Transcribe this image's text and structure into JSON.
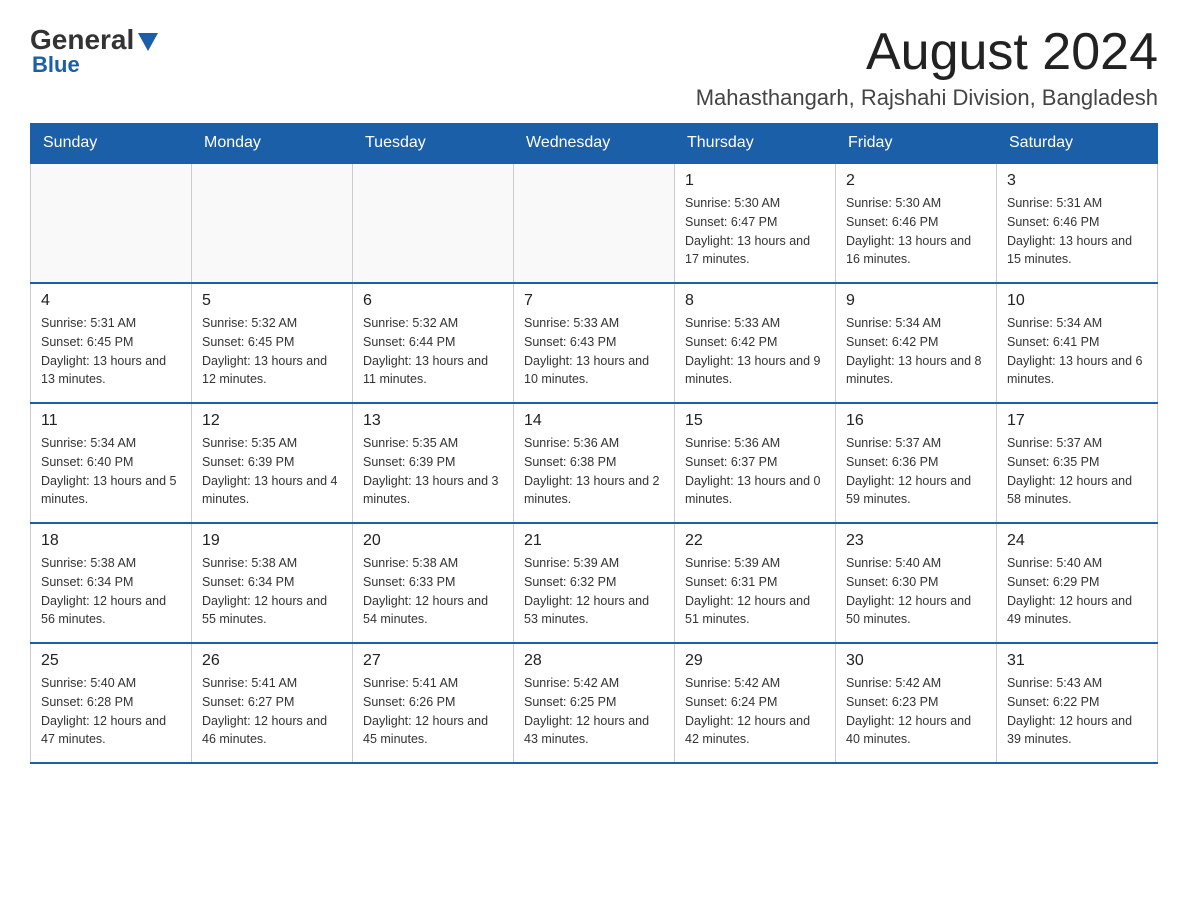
{
  "header": {
    "logo": {
      "general_text": "General",
      "blue_text": "Blue"
    },
    "title": "August 2024",
    "location": "Mahasthangarh, Rajshahi Division, Bangladesh"
  },
  "calendar": {
    "days_of_week": [
      "Sunday",
      "Monday",
      "Tuesday",
      "Wednesday",
      "Thursday",
      "Friday",
      "Saturday"
    ],
    "weeks": [
      [
        {
          "day": "",
          "info": ""
        },
        {
          "day": "",
          "info": ""
        },
        {
          "day": "",
          "info": ""
        },
        {
          "day": "",
          "info": ""
        },
        {
          "day": "1",
          "info": "Sunrise: 5:30 AM\nSunset: 6:47 PM\nDaylight: 13 hours and 17 minutes."
        },
        {
          "day": "2",
          "info": "Sunrise: 5:30 AM\nSunset: 6:46 PM\nDaylight: 13 hours and 16 minutes."
        },
        {
          "day": "3",
          "info": "Sunrise: 5:31 AM\nSunset: 6:46 PM\nDaylight: 13 hours and 15 minutes."
        }
      ],
      [
        {
          "day": "4",
          "info": "Sunrise: 5:31 AM\nSunset: 6:45 PM\nDaylight: 13 hours and 13 minutes."
        },
        {
          "day": "5",
          "info": "Sunrise: 5:32 AM\nSunset: 6:45 PM\nDaylight: 13 hours and 12 minutes."
        },
        {
          "day": "6",
          "info": "Sunrise: 5:32 AM\nSunset: 6:44 PM\nDaylight: 13 hours and 11 minutes."
        },
        {
          "day": "7",
          "info": "Sunrise: 5:33 AM\nSunset: 6:43 PM\nDaylight: 13 hours and 10 minutes."
        },
        {
          "day": "8",
          "info": "Sunrise: 5:33 AM\nSunset: 6:42 PM\nDaylight: 13 hours and 9 minutes."
        },
        {
          "day": "9",
          "info": "Sunrise: 5:34 AM\nSunset: 6:42 PM\nDaylight: 13 hours and 8 minutes."
        },
        {
          "day": "10",
          "info": "Sunrise: 5:34 AM\nSunset: 6:41 PM\nDaylight: 13 hours and 6 minutes."
        }
      ],
      [
        {
          "day": "11",
          "info": "Sunrise: 5:34 AM\nSunset: 6:40 PM\nDaylight: 13 hours and 5 minutes."
        },
        {
          "day": "12",
          "info": "Sunrise: 5:35 AM\nSunset: 6:39 PM\nDaylight: 13 hours and 4 minutes."
        },
        {
          "day": "13",
          "info": "Sunrise: 5:35 AM\nSunset: 6:39 PM\nDaylight: 13 hours and 3 minutes."
        },
        {
          "day": "14",
          "info": "Sunrise: 5:36 AM\nSunset: 6:38 PM\nDaylight: 13 hours and 2 minutes."
        },
        {
          "day": "15",
          "info": "Sunrise: 5:36 AM\nSunset: 6:37 PM\nDaylight: 13 hours and 0 minutes."
        },
        {
          "day": "16",
          "info": "Sunrise: 5:37 AM\nSunset: 6:36 PM\nDaylight: 12 hours and 59 minutes."
        },
        {
          "day": "17",
          "info": "Sunrise: 5:37 AM\nSunset: 6:35 PM\nDaylight: 12 hours and 58 minutes."
        }
      ],
      [
        {
          "day": "18",
          "info": "Sunrise: 5:38 AM\nSunset: 6:34 PM\nDaylight: 12 hours and 56 minutes."
        },
        {
          "day": "19",
          "info": "Sunrise: 5:38 AM\nSunset: 6:34 PM\nDaylight: 12 hours and 55 minutes."
        },
        {
          "day": "20",
          "info": "Sunrise: 5:38 AM\nSunset: 6:33 PM\nDaylight: 12 hours and 54 minutes."
        },
        {
          "day": "21",
          "info": "Sunrise: 5:39 AM\nSunset: 6:32 PM\nDaylight: 12 hours and 53 minutes."
        },
        {
          "day": "22",
          "info": "Sunrise: 5:39 AM\nSunset: 6:31 PM\nDaylight: 12 hours and 51 minutes."
        },
        {
          "day": "23",
          "info": "Sunrise: 5:40 AM\nSunset: 6:30 PM\nDaylight: 12 hours and 50 minutes."
        },
        {
          "day": "24",
          "info": "Sunrise: 5:40 AM\nSunset: 6:29 PM\nDaylight: 12 hours and 49 minutes."
        }
      ],
      [
        {
          "day": "25",
          "info": "Sunrise: 5:40 AM\nSunset: 6:28 PM\nDaylight: 12 hours and 47 minutes."
        },
        {
          "day": "26",
          "info": "Sunrise: 5:41 AM\nSunset: 6:27 PM\nDaylight: 12 hours and 46 minutes."
        },
        {
          "day": "27",
          "info": "Sunrise: 5:41 AM\nSunset: 6:26 PM\nDaylight: 12 hours and 45 minutes."
        },
        {
          "day": "28",
          "info": "Sunrise: 5:42 AM\nSunset: 6:25 PM\nDaylight: 12 hours and 43 minutes."
        },
        {
          "day": "29",
          "info": "Sunrise: 5:42 AM\nSunset: 6:24 PM\nDaylight: 12 hours and 42 minutes."
        },
        {
          "day": "30",
          "info": "Sunrise: 5:42 AM\nSunset: 6:23 PM\nDaylight: 12 hours and 40 minutes."
        },
        {
          "day": "31",
          "info": "Sunrise: 5:43 AM\nSunset: 6:22 PM\nDaylight: 12 hours and 39 minutes."
        }
      ]
    ]
  }
}
